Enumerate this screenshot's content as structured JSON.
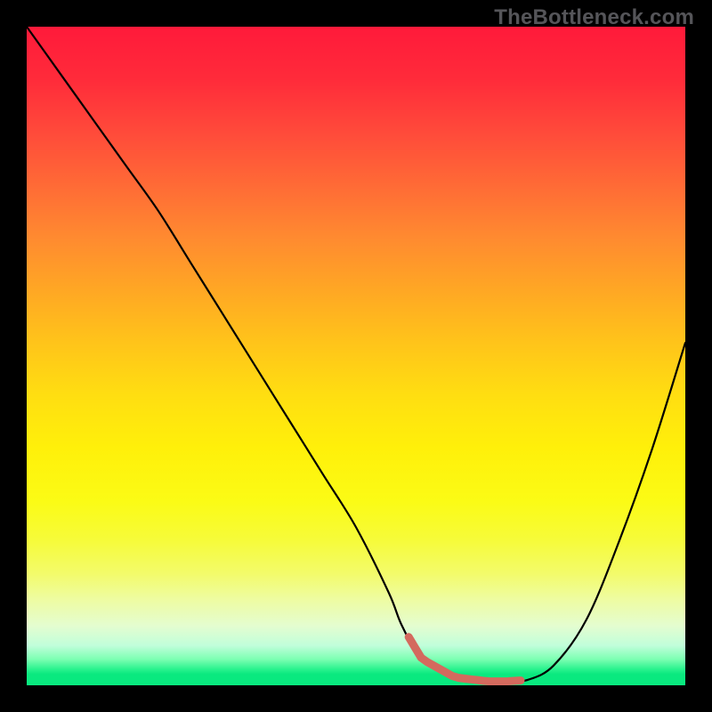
{
  "watermark": "TheBottleneck.com",
  "chart_data": {
    "type": "line",
    "title": "",
    "xlabel": "",
    "ylabel": "",
    "xlim": [
      0,
      100
    ],
    "ylim": [
      0,
      100
    ],
    "x": [
      0,
      5,
      10,
      15,
      20,
      25,
      30,
      35,
      40,
      45,
      50,
      55,
      57,
      60,
      65,
      70,
      73,
      76,
      80,
      85,
      90,
      95,
      100
    ],
    "values": [
      100,
      93,
      86,
      79,
      72,
      64,
      56,
      48,
      40,
      32,
      24,
      14,
      9,
      4,
      1.2,
      0.6,
      0.6,
      0.8,
      3,
      10,
      22,
      36,
      52
    ],
    "optimal_range_x": [
      58,
      75
    ],
    "gradient_stops": [
      {
        "pos": 0,
        "color": "#ff1a3a"
      },
      {
        "pos": 50,
        "color": "#ffd31a"
      },
      {
        "pos": 80,
        "color": "#fff81a"
      },
      {
        "pos": 99,
        "color": "#0be97f"
      }
    ]
  }
}
